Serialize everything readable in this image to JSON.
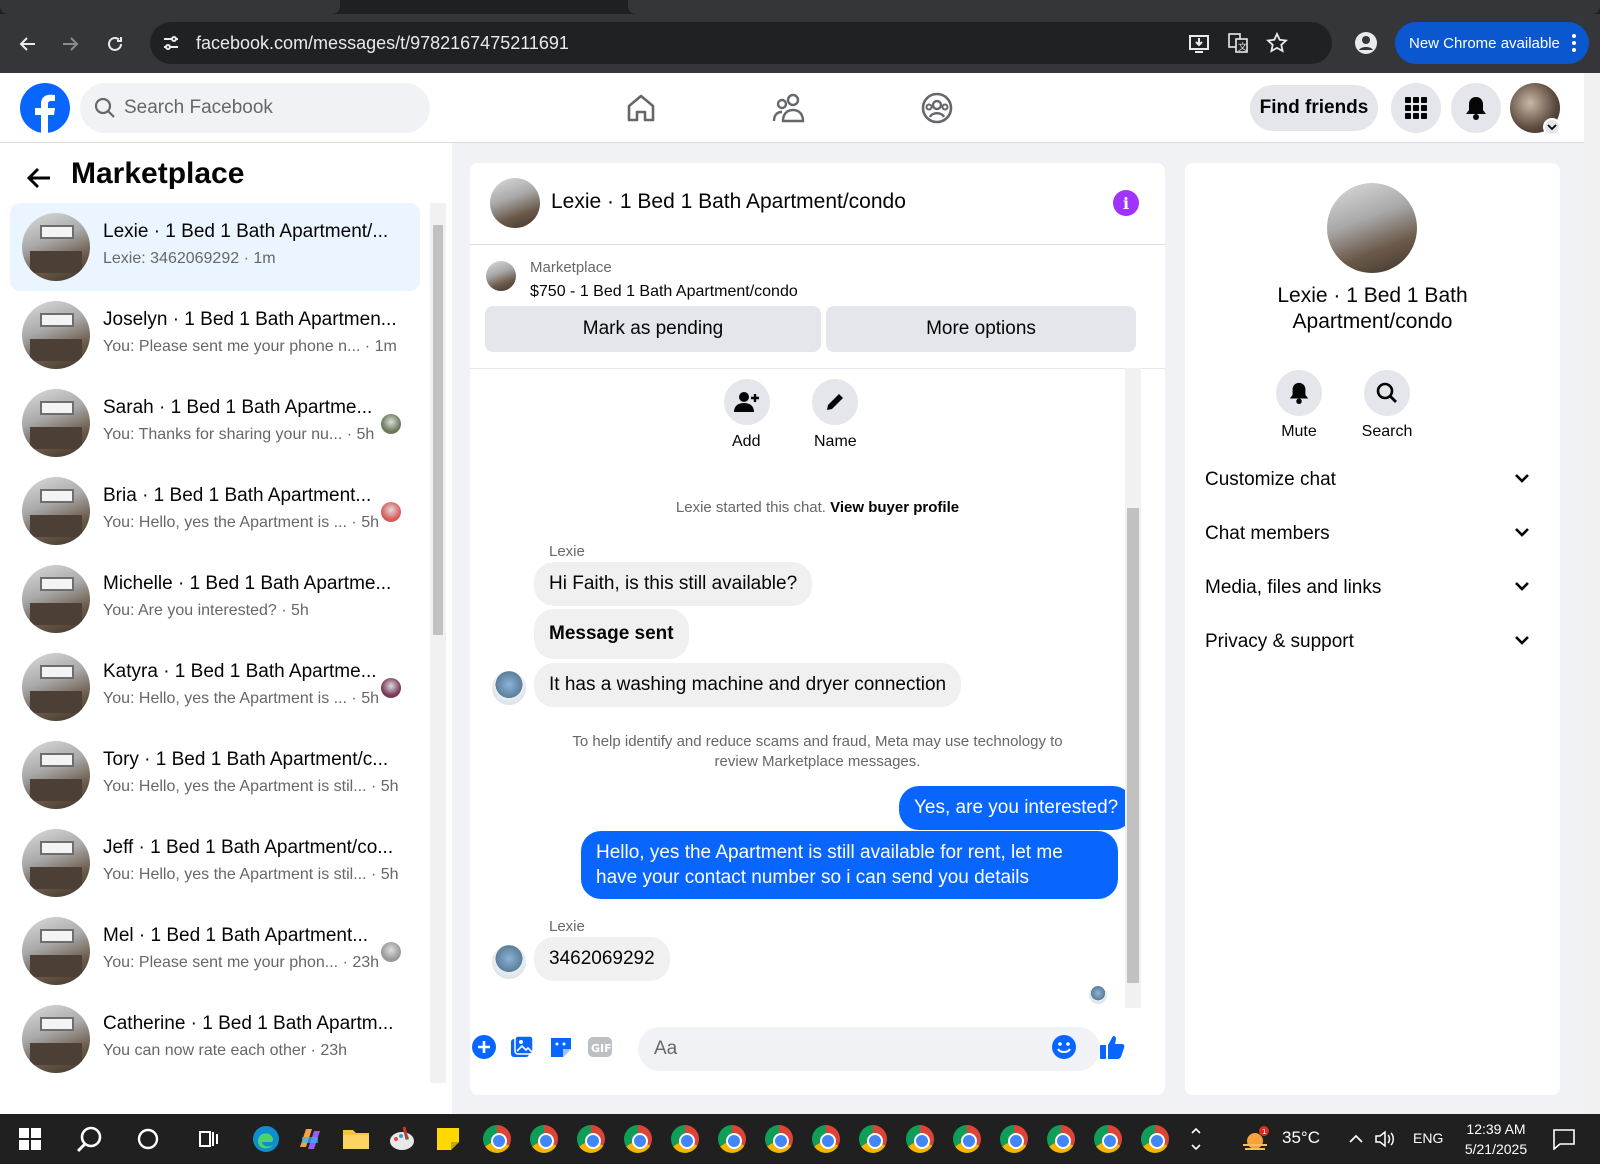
{
  "browser": {
    "url": "facebook.com/messages/t/9782167475211691",
    "new_chrome": "New Chrome available"
  },
  "header": {
    "search_placeholder": "Search Facebook",
    "find_friends": "Find friends"
  },
  "left": {
    "title": "Marketplace",
    "conversations": [
      {
        "name": "Lexie · 1 Bed 1 Bath Apartment/...",
        "snippet": "Lexie: 3462069292 · 1m",
        "active": true
      },
      {
        "name": "Joselyn · 1 Bed 1 Bath Apartmen...",
        "snippet": "You: Please sent me your phone n... · 1m"
      },
      {
        "name": "Sarah · 1 Bed 1 Bath Apartme...",
        "snippet": "You: Thanks for sharing your nu... · 5h"
      },
      {
        "name": "Bria · 1 Bed 1 Bath Apartment...",
        "snippet": "You: Hello, yes the Apartment is ... · 5h"
      },
      {
        "name": "Michelle · 1 Bed 1 Bath Apartme...",
        "snippet": "You: Are you interested? · 5h"
      },
      {
        "name": "Katyra · 1 Bed 1 Bath Apartme...",
        "snippet": "You: Hello, yes the Apartment is ... · 5h"
      },
      {
        "name": "Tory · 1 Bed 1 Bath Apartment/c...",
        "snippet": "You: Hello, yes the Apartment is stil... · 5h"
      },
      {
        "name": "Jeff · 1 Bed 1 Bath Apartment/co...",
        "snippet": "You: Hello, yes the Apartment is stil... · 5h"
      },
      {
        "name": "Mel · 1 Bed 1 Bath Apartment...",
        "snippet": "You: Please sent me your phon... · 23h"
      },
      {
        "name": "Catherine · 1 Bed 1 Bath Apartm...",
        "snippet": "You can now rate each other · 23h"
      }
    ]
  },
  "chat": {
    "title": "Lexie · 1 Bed 1 Bath Apartment/condo",
    "listing_source": "Marketplace",
    "listing": "$750 - 1 Bed 1 Bath Apartment/condo",
    "mark_pending": "Mark as pending",
    "more_options": "More options",
    "add_label": "Add",
    "name_label": "Name",
    "started_text": "Lexie started this chat.",
    "view_profile": "View buyer profile",
    "sender": "Lexie",
    "msg1": "Hi Faith, is this still available?",
    "msg2": "Message sent",
    "msg3": "It has a washing machine and dryer connection",
    "notice": "To help identify and reduce scams and fraud, Meta may use technology to review Marketplace messages.",
    "msg4": "Yes, are you interested?",
    "msg5": "Hello, yes the Apartment is still available for rent, let me have your contact number so i can send you details",
    "sender2": "Lexie",
    "msg6": "3462069292",
    "composer_placeholder": "Aa"
  },
  "right": {
    "name": "Lexie · 1 Bed 1 Bath Apartment/condo",
    "mute": "Mute",
    "search": "Search",
    "rows": [
      "Customize chat",
      "Chat members",
      "Media, files and links",
      "Privacy & support"
    ]
  },
  "taskbar": {
    "temp": "35°C",
    "lang": "ENG",
    "time": "12:39 AM",
    "date": "5/21/2025"
  }
}
